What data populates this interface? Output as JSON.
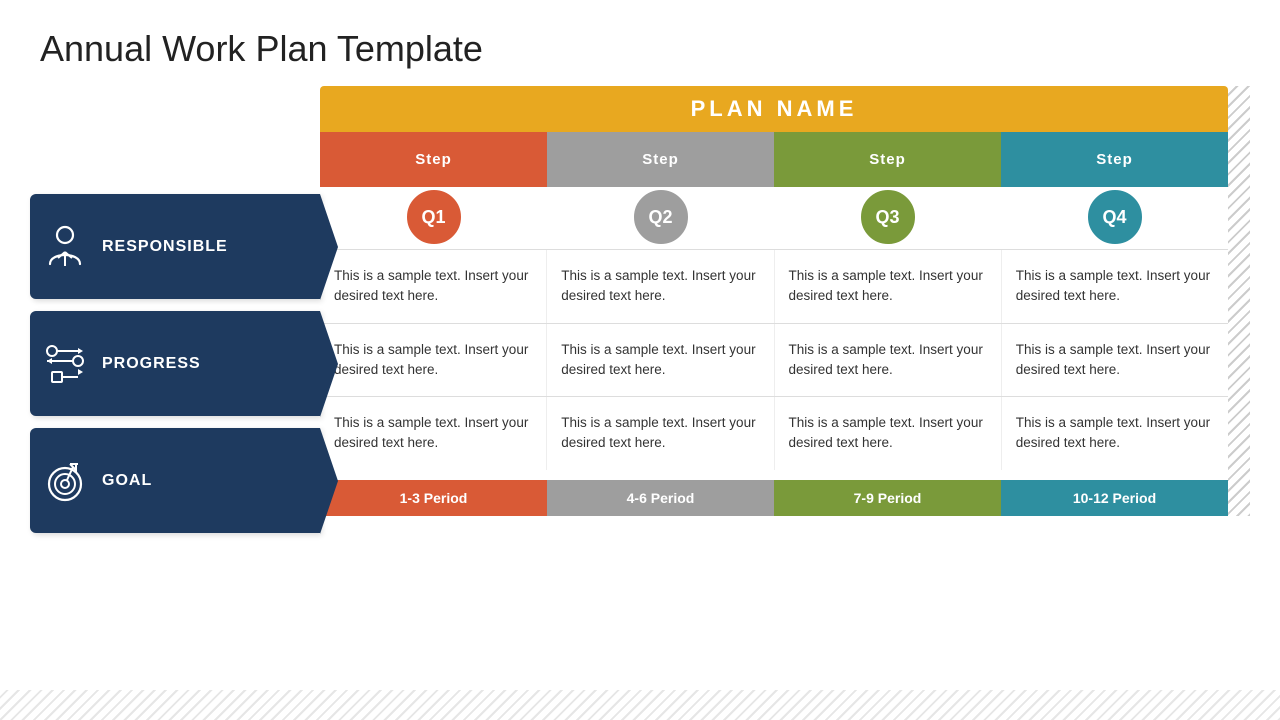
{
  "title": "Annual Work Plan Template",
  "plan_name": "PLAN NAME",
  "steps": [
    {
      "label": "Step",
      "quarter": "Q1",
      "color_key": "q1"
    },
    {
      "label": "Step",
      "quarter": "Q2",
      "color_key": "q2"
    },
    {
      "label": "Step",
      "quarter": "Q3",
      "color_key": "q3"
    },
    {
      "label": "Step",
      "quarter": "Q4",
      "color_key": "q4"
    }
  ],
  "rows": [
    {
      "id": "responsible",
      "label": "RESPONSIBLE",
      "icon": "person",
      "cells": [
        "This is a sample text. Insert your desired text here.",
        "This is a sample text. Insert your desired text here.",
        "This is a sample text. Insert your desired text here.",
        "This is a sample text. Insert your desired text here."
      ]
    },
    {
      "id": "progress",
      "label": "PROGRESS",
      "icon": "arrows",
      "cells": [
        "This is a sample text. Insert your desired text here.",
        "This is a sample text. Insert your desired text here.",
        "This is a sample text. Insert your desired text here.",
        "This is a sample text. Insert your desired text here."
      ]
    },
    {
      "id": "goal",
      "label": "GOAL",
      "icon": "target",
      "cells": [
        "This is a sample text. Insert your desired text here.",
        "This is a sample text. Insert your desired text here.",
        "This is a sample text. Insert your desired text here.",
        "This is a sample text. Insert your desired text here."
      ]
    }
  ],
  "periods": [
    {
      "label": "1-3 Period",
      "color_key": "q1"
    },
    {
      "label": "4-6 Period",
      "color_key": "q2"
    },
    {
      "label": "7-9 Period",
      "color_key": "q3"
    },
    {
      "label": "10-12 Period",
      "color_key": "q4"
    }
  ]
}
